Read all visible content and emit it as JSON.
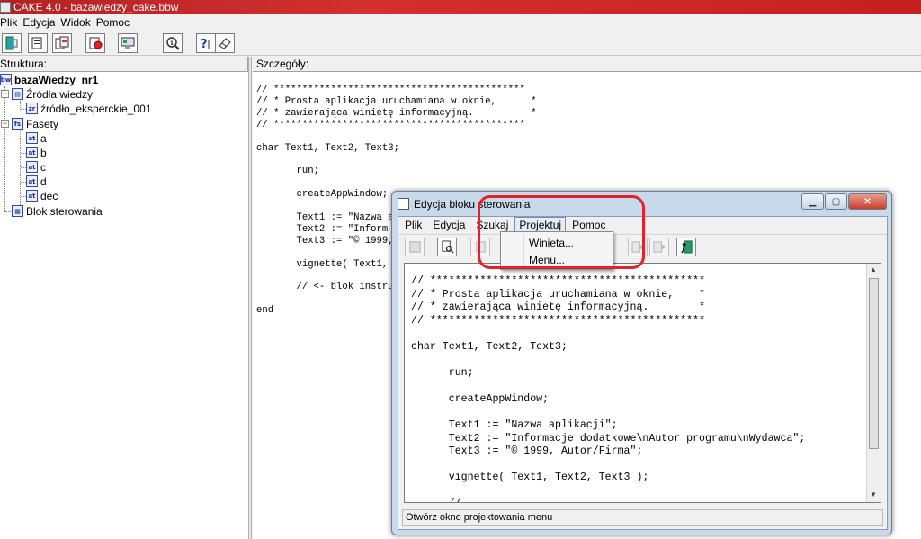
{
  "window": {
    "title": "CAKE 4.0 - bazawiedzy_cake.bbw"
  },
  "menu": [
    "Plik",
    "Edycja",
    "Widok",
    "Pomoc"
  ],
  "toolbar": {
    "icons": [
      "exit-icon",
      "new-document-icon",
      "copy-document-icon",
      "open-document-icon",
      "properties-icon",
      "info-icon",
      "help-icon",
      "eraser-icon"
    ]
  },
  "panels": {
    "left_header": "Struktura:",
    "right_header": "Szczegóły:"
  },
  "tree": {
    "root": "bazaWiedzy_nr1",
    "sources": "Źródła wiedzy",
    "source_item": "źródło_eksperckie_001",
    "facets": "Fasety",
    "facet_items": [
      "a",
      "b",
      "c",
      "d",
      "dec"
    ],
    "control_block": "Blok sterowania",
    "badges": {
      "root": "bw",
      "source": "źr",
      "facets": "fs",
      "item": "at"
    }
  },
  "detail_code": "// ********************************************\n// * Prosta aplikacja uruchamiana w oknie,      *\n// * zawierająca winietę informacyjną.          *\n// ********************************************\n\nchar Text1, Text2, Text3;\n\n       run;\n\n       createAppWindow;\n\n       Text1 := \"Nazwa a\n       Text2 := \"Inform\n       Text3 := \"© 1999,\n\n       vignette( Text1,\n\n       // <- blok instru\n\nend",
  "dialog": {
    "title": "Edycja bloku sterowania",
    "menu": [
      "Plik",
      "Edycja",
      "Szukaj",
      "Projektuj",
      "Pomoc"
    ],
    "active_menu": "Projektuj",
    "dropdown": [
      "Winieta...",
      "Menu..."
    ],
    "code": "// ********************************************\n// * Prosta aplikacja uruchamiana w oknie,    *\n// * zawierająca winietę informacyjną.        *\n// ********************************************\n\nchar Text1, Text2, Text3;\n\n      run;\n\n      createAppWindow;\n\n      Text1 := \"Nazwa aplikacji\";\n      Text2 := \"Informacje dodatkowe\\nAutor programu\\nWydawca\";\n      Text3 := \"© 1999, Autor/Firma\";\n\n      vignette( Text1, Text2, Text3 );\n\n      //",
    "status": "Otwórz okno projektowania menu"
  },
  "colors": {
    "titlebar": "#c62828",
    "highlight": "#e0222a",
    "dialog_frame": "#c9d9ec"
  }
}
